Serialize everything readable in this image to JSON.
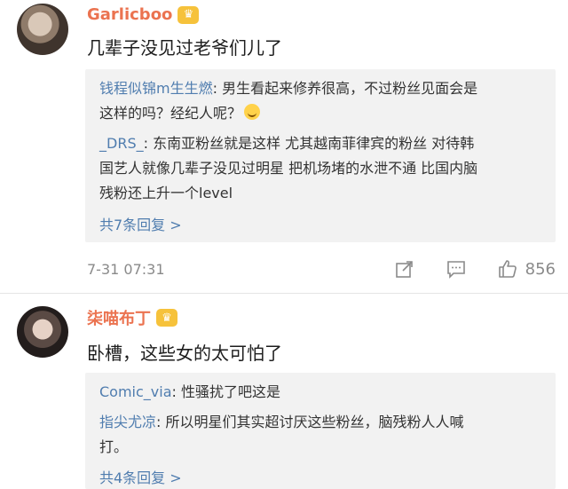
{
  "comments": [
    {
      "username": "Garlicboo",
      "text": "几辈子没见过老爷们儿了",
      "replies": [
        {
          "user": "钱程似锦m生生燃",
          "line1": ": 男生看起来修养很高，不过粉丝见面会是",
          "line2": "这样的吗？经纪人呢？"
        },
        {
          "user": "_DRS_",
          "line1": ": 东南亚粉丝就是这样 尤其越南菲律宾的粉丝 对待韩",
          "line2": "国艺人就像几辈子没见过明星 把机场堵的水泄不通 比国内脑",
          "line3": "残粉还上升一个level"
        }
      ],
      "more_replies": "共7条回复 >",
      "time": "7-31 07:31",
      "likes": "856"
    },
    {
      "username": "柒喵布丁",
      "text": "卧槽，这些女的太可怕了",
      "replies": [
        {
          "user": "Comic_via",
          "line1": ": 性骚扰了吧这是"
        },
        {
          "user": "指尖尤凉",
          "line1": ": 所以明星们其实超讨厌这些粉丝，脑残粉人人喊",
          "line2": "打。"
        }
      ],
      "more_replies": "共4条回复 >"
    }
  ],
  "icons": {
    "badge": "crown-badge-icon",
    "share": "share-icon",
    "comment": "comment-icon",
    "like": "thumbs-up-icon"
  },
  "colors": {
    "username": "#eb7350",
    "link": "#507daf",
    "reply_bg": "#f2f2f2"
  }
}
